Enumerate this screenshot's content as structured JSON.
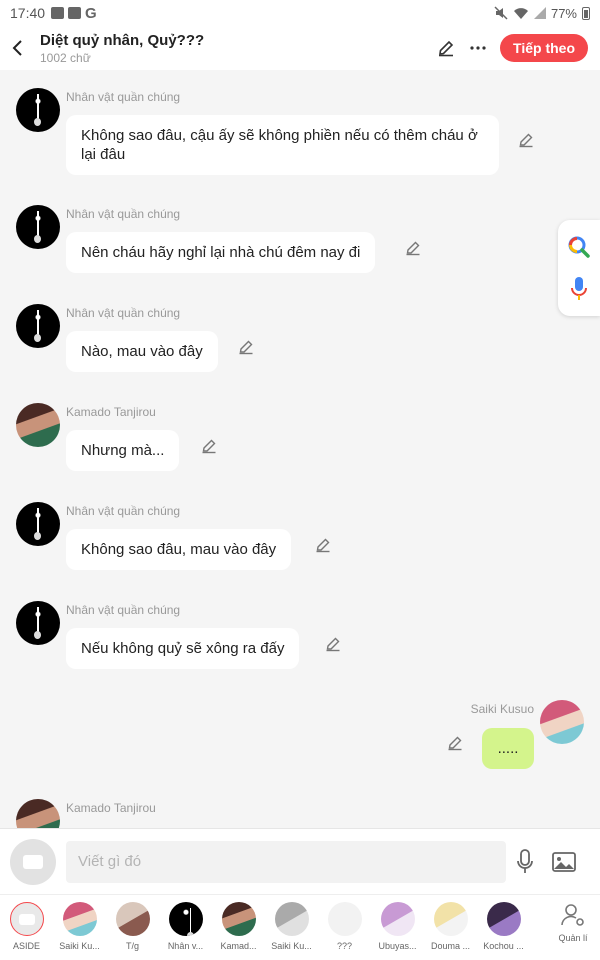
{
  "status": {
    "time": "17:40",
    "battery": "77%",
    "left_icons": [
      "image-icon",
      "bag-icon",
      "google-icon"
    ],
    "right_icons": [
      "mute-icon",
      "wifi-icon",
      "signal-icon",
      "battery-icon"
    ]
  },
  "header": {
    "title": "Diệt quỷ nhân, Quỷ???",
    "subtitle": "1002 chữ",
    "next_label": "Tiếp theo"
  },
  "messages": [
    {
      "sender": "Nhân vật quần chúng",
      "text": "Không sao đâu, cậu ấy sẽ không phiền nếu có thêm cháu ở lại đâu"
    },
    {
      "sender": "Nhân vật quần chúng",
      "text": "Nên cháu hãy nghỉ lại nhà chú đêm nay đi"
    },
    {
      "sender": "Nhân vật quần chúng",
      "text": "Nào, mau vào đây"
    },
    {
      "sender": "Kamado Tanjirou",
      "text": "Nhưng mà..."
    },
    {
      "sender": "Nhân vật quần chúng",
      "text": "Không sao đâu, mau vào đây"
    },
    {
      "sender": "Nhân vật quần chúng",
      "text": "Nếu không quỷ sẽ xông ra đấy"
    },
    {
      "sender": "Saiki Kusuo",
      "text": "....."
    },
    {
      "sender": "Kamado Tanjirou",
      "text": ""
    }
  ],
  "composer": {
    "placeholder": "Viết gì đó"
  },
  "characters": [
    {
      "label": "ASIDE"
    },
    {
      "label": "Saiki Ku..."
    },
    {
      "label": "T/g"
    },
    {
      "label": "Nhân v..."
    },
    {
      "label": "Kamad..."
    },
    {
      "label": "Saiki Ku..."
    },
    {
      "label": "???"
    },
    {
      "label": "Ubuyas..."
    },
    {
      "label": "Douma ..."
    },
    {
      "label": "Kochou ..."
    }
  ],
  "manage_label": "Quản lí",
  "colors": {
    "accent": "#f4474b",
    "my_bubble": "#d4f48c",
    "background": "#f5f5f5"
  }
}
